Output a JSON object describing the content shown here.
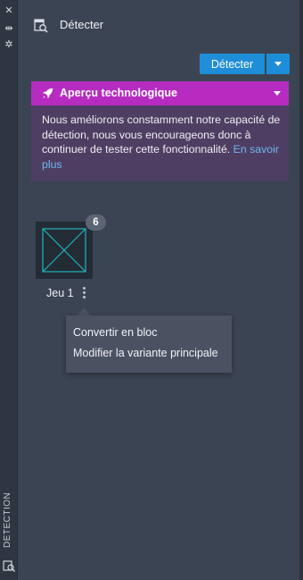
{
  "side_strip": {
    "close_glyph": "✕",
    "pin_glyph": "⇹",
    "settings_glyph": "✲",
    "vertical_label": "DETECTION"
  },
  "header": {
    "title": "Détecter",
    "icon": "detect-window-icon"
  },
  "toolbar": {
    "detect_label": "Détecter",
    "dropdown_icon": "chevron-down-icon"
  },
  "banner": {
    "title": "Aperçu technologique",
    "body": "Nous améliorons constamment notre capacité de détection, nous vous encourageons donc à continuer de tester cette fonctionnalité. ",
    "link": "En savoir plus",
    "header_color": "#b62cc1",
    "body_color": "#4f3e63"
  },
  "results": {
    "item_label": "Jeu 1",
    "count_badge": "6"
  },
  "context_menu": {
    "items": [
      "Convertir en bloc",
      "Modifier la variante principale"
    ]
  },
  "colors": {
    "background": "#3b4453",
    "accent": "#1f8ed8",
    "thumbnail_stroke": "#22b5b8"
  }
}
